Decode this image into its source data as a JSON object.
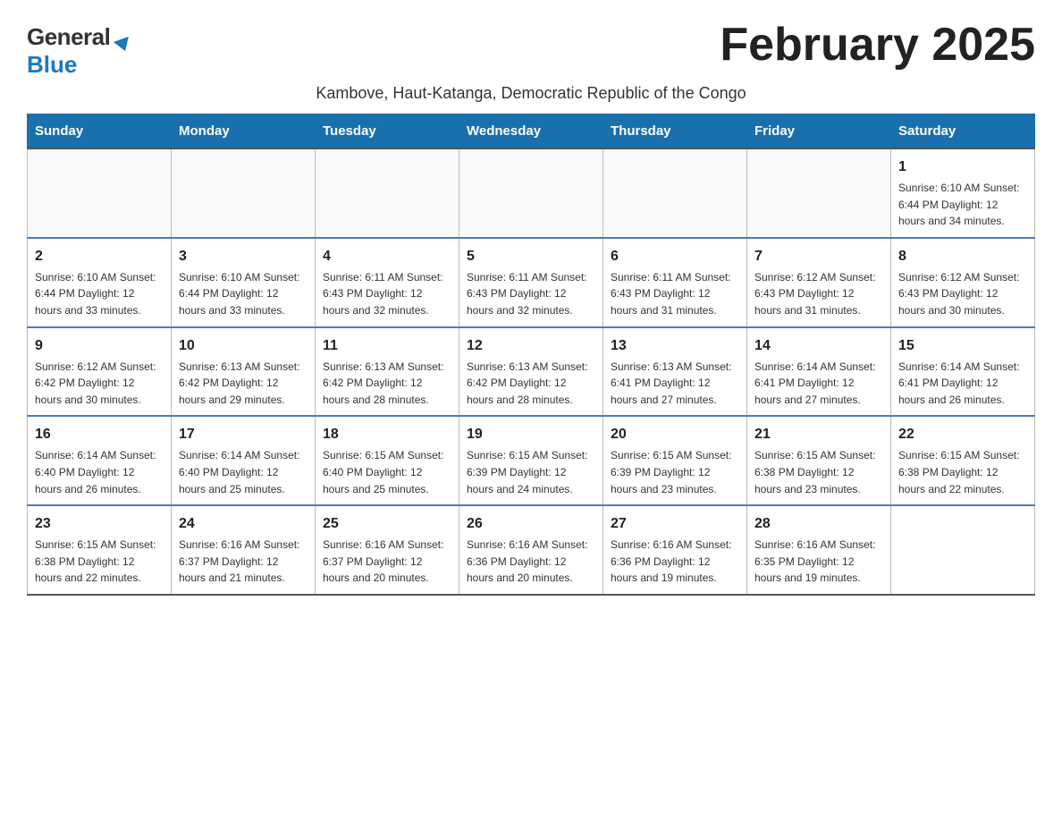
{
  "header": {
    "logo_general": "General",
    "logo_blue": "Blue",
    "month_title": "February 2025",
    "subtitle": "Kambove, Haut-Katanga, Democratic Republic of the Congo"
  },
  "days_of_week": [
    "Sunday",
    "Monday",
    "Tuesday",
    "Wednesday",
    "Thursday",
    "Friday",
    "Saturday"
  ],
  "weeks": [
    {
      "days": [
        {
          "number": "",
          "info": ""
        },
        {
          "number": "",
          "info": ""
        },
        {
          "number": "",
          "info": ""
        },
        {
          "number": "",
          "info": ""
        },
        {
          "number": "",
          "info": ""
        },
        {
          "number": "",
          "info": ""
        },
        {
          "number": "1",
          "info": "Sunrise: 6:10 AM\nSunset: 6:44 PM\nDaylight: 12 hours\nand 34 minutes."
        }
      ]
    },
    {
      "days": [
        {
          "number": "2",
          "info": "Sunrise: 6:10 AM\nSunset: 6:44 PM\nDaylight: 12 hours\nand 33 minutes."
        },
        {
          "number": "3",
          "info": "Sunrise: 6:10 AM\nSunset: 6:44 PM\nDaylight: 12 hours\nand 33 minutes."
        },
        {
          "number": "4",
          "info": "Sunrise: 6:11 AM\nSunset: 6:43 PM\nDaylight: 12 hours\nand 32 minutes."
        },
        {
          "number": "5",
          "info": "Sunrise: 6:11 AM\nSunset: 6:43 PM\nDaylight: 12 hours\nand 32 minutes."
        },
        {
          "number": "6",
          "info": "Sunrise: 6:11 AM\nSunset: 6:43 PM\nDaylight: 12 hours\nand 31 minutes."
        },
        {
          "number": "7",
          "info": "Sunrise: 6:12 AM\nSunset: 6:43 PM\nDaylight: 12 hours\nand 31 minutes."
        },
        {
          "number": "8",
          "info": "Sunrise: 6:12 AM\nSunset: 6:43 PM\nDaylight: 12 hours\nand 30 minutes."
        }
      ]
    },
    {
      "days": [
        {
          "number": "9",
          "info": "Sunrise: 6:12 AM\nSunset: 6:42 PM\nDaylight: 12 hours\nand 30 minutes."
        },
        {
          "number": "10",
          "info": "Sunrise: 6:13 AM\nSunset: 6:42 PM\nDaylight: 12 hours\nand 29 minutes."
        },
        {
          "number": "11",
          "info": "Sunrise: 6:13 AM\nSunset: 6:42 PM\nDaylight: 12 hours\nand 28 minutes."
        },
        {
          "number": "12",
          "info": "Sunrise: 6:13 AM\nSunset: 6:42 PM\nDaylight: 12 hours\nand 28 minutes."
        },
        {
          "number": "13",
          "info": "Sunrise: 6:13 AM\nSunset: 6:41 PM\nDaylight: 12 hours\nand 27 minutes."
        },
        {
          "number": "14",
          "info": "Sunrise: 6:14 AM\nSunset: 6:41 PM\nDaylight: 12 hours\nand 27 minutes."
        },
        {
          "number": "15",
          "info": "Sunrise: 6:14 AM\nSunset: 6:41 PM\nDaylight: 12 hours\nand 26 minutes."
        }
      ]
    },
    {
      "days": [
        {
          "number": "16",
          "info": "Sunrise: 6:14 AM\nSunset: 6:40 PM\nDaylight: 12 hours\nand 26 minutes."
        },
        {
          "number": "17",
          "info": "Sunrise: 6:14 AM\nSunset: 6:40 PM\nDaylight: 12 hours\nand 25 minutes."
        },
        {
          "number": "18",
          "info": "Sunrise: 6:15 AM\nSunset: 6:40 PM\nDaylight: 12 hours\nand 25 minutes."
        },
        {
          "number": "19",
          "info": "Sunrise: 6:15 AM\nSunset: 6:39 PM\nDaylight: 12 hours\nand 24 minutes."
        },
        {
          "number": "20",
          "info": "Sunrise: 6:15 AM\nSunset: 6:39 PM\nDaylight: 12 hours\nand 23 minutes."
        },
        {
          "number": "21",
          "info": "Sunrise: 6:15 AM\nSunset: 6:38 PM\nDaylight: 12 hours\nand 23 minutes."
        },
        {
          "number": "22",
          "info": "Sunrise: 6:15 AM\nSunset: 6:38 PM\nDaylight: 12 hours\nand 22 minutes."
        }
      ]
    },
    {
      "days": [
        {
          "number": "23",
          "info": "Sunrise: 6:15 AM\nSunset: 6:38 PM\nDaylight: 12 hours\nand 22 minutes."
        },
        {
          "number": "24",
          "info": "Sunrise: 6:16 AM\nSunset: 6:37 PM\nDaylight: 12 hours\nand 21 minutes."
        },
        {
          "number": "25",
          "info": "Sunrise: 6:16 AM\nSunset: 6:37 PM\nDaylight: 12 hours\nand 20 minutes."
        },
        {
          "number": "26",
          "info": "Sunrise: 6:16 AM\nSunset: 6:36 PM\nDaylight: 12 hours\nand 20 minutes."
        },
        {
          "number": "27",
          "info": "Sunrise: 6:16 AM\nSunset: 6:36 PM\nDaylight: 12 hours\nand 19 minutes."
        },
        {
          "number": "28",
          "info": "Sunrise: 6:16 AM\nSunset: 6:35 PM\nDaylight: 12 hours\nand 19 minutes."
        },
        {
          "number": "",
          "info": ""
        }
      ]
    }
  ]
}
